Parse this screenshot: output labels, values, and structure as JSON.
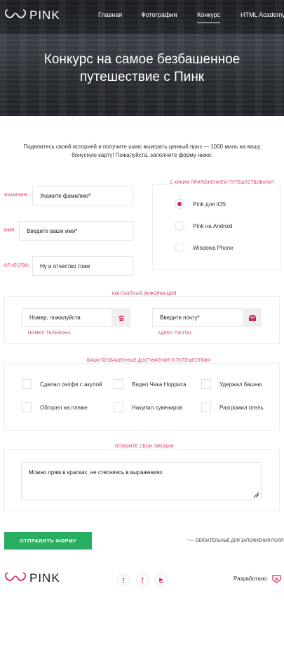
{
  "brand": {
    "logo_text": "PINK",
    "accent": "#d22856",
    "button_color": "#27ae60"
  },
  "nav": [
    {
      "label": "Главная"
    },
    {
      "label": "Фотографии"
    },
    {
      "label": "Конкурс",
      "active": true
    },
    {
      "label": "HTML Academy"
    }
  ],
  "hero": {
    "title": "Конкурс на самое безбашенное путешествие с Пинк"
  },
  "intro": "Поделитесь своей историей и получите шанс выиграть ценный приз — 1000 миль на вашу бонусную карту! Пожалуйста, заполните форму ниже:",
  "personal": {
    "surname": {
      "label": "ФАМИЛИЯ:",
      "placeholder": "Укажите фамилию*"
    },
    "name": {
      "label": "ИМЯ:",
      "placeholder": "Введите ваше имя*"
    },
    "patronymic": {
      "label": "ОТЧЕСТВО:",
      "placeholder": "Ну и отчество тоже"
    }
  },
  "app": {
    "legend": "С КАКИМ ПРИЛОЖЕНИЕМ ПУТЕШЕСТВОВАЛИ?",
    "options": [
      "Pink для iOS",
      "Pink на Android",
      "Windows Phone"
    ],
    "selected": "Pink для iOS"
  },
  "contacts": {
    "legend": "КОНТАКТНАЯ ИНФОРМАЦИЯ",
    "phone": {
      "placeholder": "Номер, пожалуйста",
      "caption": "НОМЕР ТЕЛЕФОНА",
      "icon": "phone-icon"
    },
    "email": {
      "placeholder": "Введите почту*",
      "caption": "АДРЕС ПОЧТЫ",
      "icon": "mail-icon"
    }
  },
  "achievements": {
    "legend": "ВАШИ БЕЗБАШЕННЫЕ ДОСТИЖЕНИЯ В ПУТЕШЕСТВИИ",
    "items": [
      "Сделал селфи с акулой",
      "Видел Чака Норриса",
      "Удержал башню",
      "Обгорел на пляже",
      "Накупил сувениров",
      "Разгромил отель"
    ]
  },
  "emotions": {
    "legend": "ОПИШИТЕ СВОИ ЭМОЦИИ",
    "placeholder": "Можно прям в красках, не стесняясь в выражениях"
  },
  "submit": {
    "label": "ОТПРАВИТЬ ФОРМУ"
  },
  "required_note": {
    "star": "*",
    "text": " — ОБЯЗАТЕЛЬНЫЕ ДЛЯ ЗАПОЛНЕНИЯ ПОЛЯ"
  },
  "footer": {
    "social": [
      {
        "icon": "twitter-icon",
        "glyph": "t"
      },
      {
        "icon": "facebook-icon",
        "glyph": "f"
      },
      {
        "icon": "youtube-icon",
        "glyph": "▶"
      }
    ],
    "developed": "Разработано"
  }
}
